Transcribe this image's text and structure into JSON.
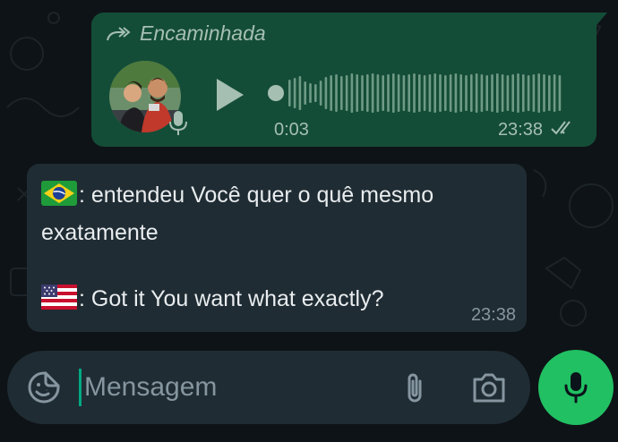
{
  "colors": {
    "background": "#0e1317",
    "outgoing_bubble": "#144d37",
    "incoming_bubble": "#1f2c33",
    "accent_green": "#21c063",
    "caret": "#00a884",
    "meta_text_out": "#a6bfb3",
    "meta_text_in": "#8696a0",
    "text": "#e9edef"
  },
  "voice_message": {
    "forwarded_label": "Encaminhada",
    "forwarded_icon": "forward-double-arrow-icon",
    "avatar_icon": "profile-photo-two-people",
    "mic_badge_icon": "microphone-icon",
    "play_icon": "play-icon",
    "duration": "0:03",
    "progress": 0,
    "time": "23:38",
    "status_icon": "double-check-icon"
  },
  "text_message": {
    "line1_flag": "flag-brazil",
    "line1": ": entendeu Você quer o quê mesmo",
    "line1_cont": "exatamente",
    "line2_flag": "flag-usa",
    "line2": ": Got it You want what exactly?",
    "time": "23:38"
  },
  "composer": {
    "placeholder": "Mensagem",
    "value": "",
    "emoji_icon": "sticker-emoji-icon",
    "attach_icon": "paperclip-icon",
    "camera_icon": "camera-icon",
    "mic_icon": "microphone-icon"
  }
}
